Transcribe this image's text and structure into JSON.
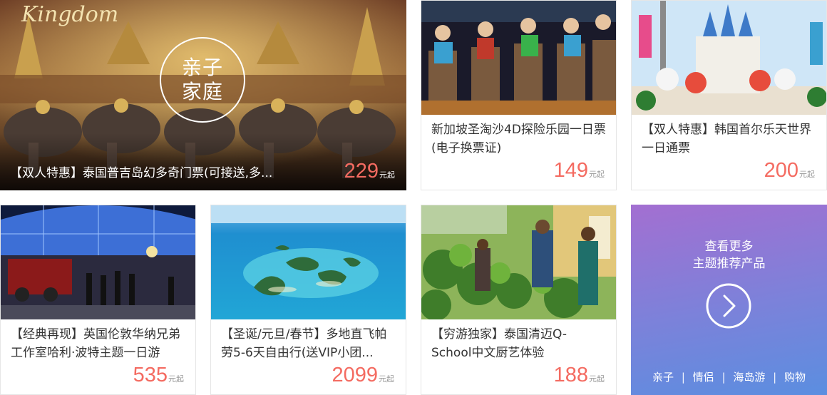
{
  "featured": {
    "badge_line1": "亲子",
    "badge_line2": "家庭",
    "title": "【双人特惠】泰国普吉岛幻多奇门票(可接送,多...",
    "price": "229",
    "unit": "元起",
    "logo_text": "Kingdom"
  },
  "cards": [
    {
      "title": "新加坡圣淘沙4D探险乐园一日票(电子换票证)",
      "price": "149",
      "unit": "元起"
    },
    {
      "title": "【双人特惠】韩国首尔乐天世界一日通票",
      "price": "200",
      "unit": "元起"
    },
    {
      "title": "【经典再现】英国伦敦华纳兄弟工作室哈利·波特主题一日游",
      "price": "535",
      "unit": "元起"
    },
    {
      "title": "【圣诞/元旦/春节】多地直飞帕劳5-6天自由行(送VIP小团...",
      "price": "2099",
      "unit": "元起"
    },
    {
      "title": "【穷游独家】泰国清迈Q-School中文厨艺体验",
      "price": "188",
      "unit": "元起"
    }
  ],
  "more": {
    "line1": "查看更多",
    "line2": "主题推荐产品",
    "tags": [
      "亲子",
      "情侣",
      "海岛游",
      "购物"
    ],
    "separator": "|"
  }
}
